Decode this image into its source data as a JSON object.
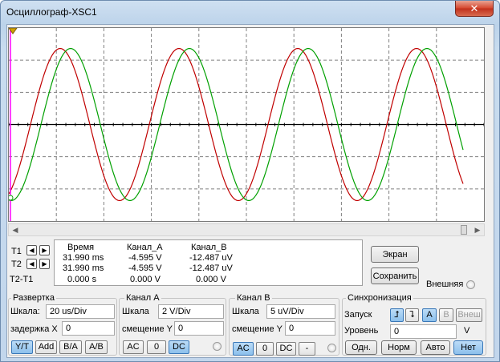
{
  "window": {
    "title": "Осциллограф-XSC1",
    "close_label": "✕"
  },
  "cursors": {
    "t1_label": "T1",
    "t2_label": "T2",
    "diff_label": "T2-T1",
    "headers": {
      "time": "Время",
      "channel_a": "Канал_A",
      "channel_b": "Канал_B"
    },
    "rows": [
      {
        "time": "31.990 ms",
        "a": "-4.595 V",
        "b": "-12.487 uV"
      },
      {
        "time": "31.990 ms",
        "a": "-4.595 V",
        "b": "-12.487 uV"
      },
      {
        "time": "0.000 s",
        "a": "0.000 V",
        "b": "0.000 V"
      }
    ]
  },
  "buttons": {
    "screen": "Экран",
    "save": "Сохранить",
    "external": "Внешняя"
  },
  "timebase": {
    "title": "Развертка",
    "scale_label": "Шкала:",
    "scale_value": "20 us/Div",
    "delay_label": "задержка X",
    "delay_value": "0",
    "modes": [
      "Y/T",
      "Add",
      "B/A",
      "A/B"
    ],
    "active_mode": "Y/T"
  },
  "channel_a": {
    "title": "Канал A",
    "scale_label": "Шкала",
    "scale_value": "2  V/Div",
    "offset_label": "смещение Y",
    "offset_value": "0",
    "coupling": [
      "AC",
      "0",
      "DC"
    ],
    "active": "DC"
  },
  "channel_b": {
    "title": "Канал B",
    "scale_label": "Шкала",
    "scale_value": "5 uV/Div",
    "offset_label": "смещение Y",
    "offset_value": "0",
    "coupling": [
      "AC",
      "0",
      "DC",
      "-"
    ],
    "active": "AC"
  },
  "trigger": {
    "title": "Синхронизация",
    "start_label": "Запуск",
    "sources": [
      "A",
      "B",
      "Внеш"
    ],
    "active_source": "A",
    "level_label": "Уровень",
    "level_value": "0",
    "level_unit": "V",
    "modes": [
      "Одн.",
      "Норм",
      "Авто",
      "Нет"
    ],
    "active_mode": "Нет"
  },
  "colors": {
    "channel_a": "#c00000",
    "channel_b": "#00a000",
    "grid": "#000000",
    "cursor": "#ff00ff"
  }
}
